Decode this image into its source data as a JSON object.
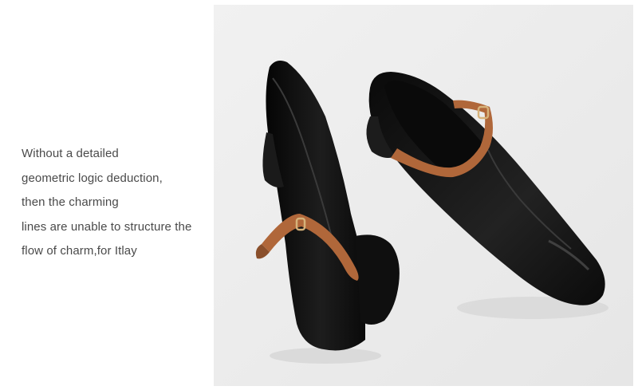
{
  "description": {
    "lines": [
      "Without a detailed",
      "geometric logic deduction,",
      "then the charming",
      "lines are unable to structure the",
      "flow of charm,for Itlay"
    ]
  },
  "photo": {
    "background_color": "#ececec",
    "leather_color": "#141414",
    "strap_color": "#b0673a",
    "buckle_color": "#d6b27a"
  }
}
